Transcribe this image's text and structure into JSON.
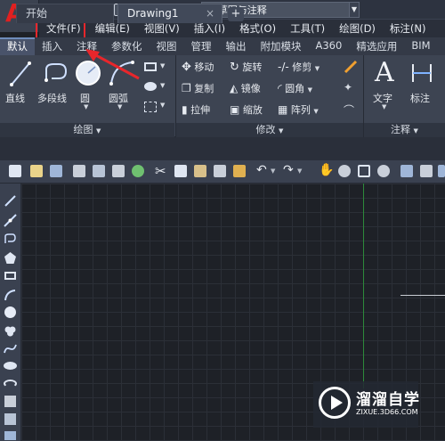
{
  "window": {
    "workspace_title": "草图与注释"
  },
  "menubar": {
    "items": [
      "文件(F)",
      "编辑(E)",
      "视图(V)",
      "插入(I)",
      "格式(O)",
      "工具(T)",
      "绘图(D)",
      "标注(N)"
    ],
    "highlighted": "文件(F)"
  },
  "ribbon_tabs": {
    "items": [
      "默认",
      "插入",
      "注释",
      "参数化",
      "视图",
      "管理",
      "输出",
      "附加模块",
      "A360",
      "精选应用",
      "BIM"
    ],
    "active": "默认"
  },
  "ribbon": {
    "draw": {
      "title": "绘图",
      "tools": [
        "直线",
        "多段线",
        "圆",
        "圆弧"
      ]
    },
    "modify": {
      "title": "修改",
      "rows": [
        [
          "移动",
          "旋转",
          "修剪"
        ],
        [
          "复制",
          "镜像",
          "圆角"
        ],
        [
          "拉伸",
          "缩放",
          "阵列"
        ]
      ]
    },
    "annotation": {
      "title": "注释",
      "tools": [
        "文字",
        "标注"
      ]
    }
  },
  "doc_tabs": {
    "start": "开始",
    "drawing": "Drawing1",
    "close_glyph": "×",
    "add_glyph": "+"
  },
  "watermark": {
    "name": "溜溜自学",
    "url": "ZIXUE.3D66.COM"
  },
  "colors": {
    "highlight_box": "#e8262b",
    "annotation_arrow": "#e8262b",
    "y_axis": "#2d8a3a",
    "brand_red": "#e02020"
  }
}
